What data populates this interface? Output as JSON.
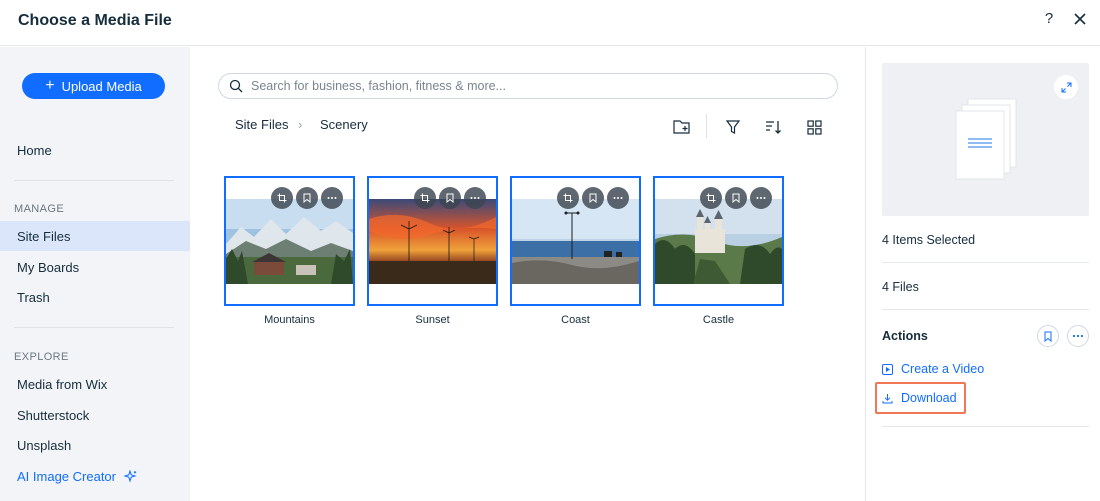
{
  "dialog": {
    "title": "Choose a Media File",
    "help_label": "?"
  },
  "sidebar": {
    "upload_label": "Upload Media",
    "home_label": "Home",
    "manage_label": "MANAGE",
    "manage_items": [
      "Site Files",
      "My Boards",
      "Trash"
    ],
    "explore_label": "EXPLORE",
    "explore_items": [
      "Media from Wix",
      "Shutterstock",
      "Unsplash"
    ],
    "ai_label": "AI Image Creator",
    "active_item": "Site Files"
  },
  "search": {
    "placeholder": "Search for business, fashion, fitness & more..."
  },
  "breadcrumb": {
    "root": "Site Files",
    "separator": "›",
    "current": "Scenery"
  },
  "files": [
    {
      "name": "Mountains",
      "selected": true
    },
    {
      "name": "Sunset",
      "selected": true
    },
    {
      "name": "Coast",
      "selected": true
    },
    {
      "name": "Castle",
      "selected": true
    }
  ],
  "details": {
    "selected_text": "4 Items Selected",
    "files_text": "4 Files",
    "actions_title": "Actions",
    "create_video_label": "Create a Video",
    "download_label": "Download"
  },
  "colors": {
    "accent": "#116dff",
    "selection_border": "#116dff",
    "highlight": "#f07856",
    "sidebar_bg": "#f2f4f7",
    "active_bg": "#dbe6fb"
  }
}
